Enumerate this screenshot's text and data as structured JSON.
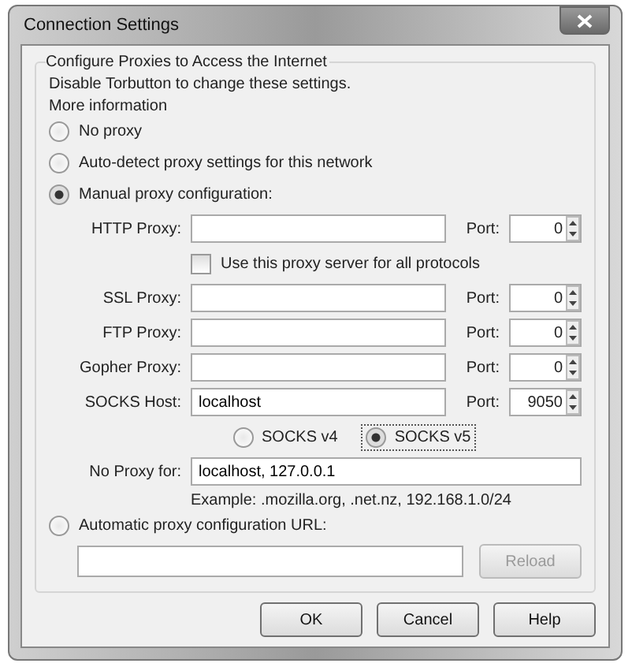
{
  "window": {
    "title": "Connection Settings"
  },
  "group": {
    "legend": "Configure Proxies to Access the Internet",
    "notes": [
      "Disable Torbutton to change these settings.",
      "More information"
    ]
  },
  "modes": [
    {
      "label": "No proxy",
      "selected": false
    },
    {
      "label": "Auto-detect proxy settings for this network",
      "selected": false
    },
    {
      "label": "Manual proxy configuration:",
      "selected": true
    }
  ],
  "proxies": [
    {
      "label": "HTTP Proxy:",
      "port_label": "Port:",
      "port": "0"
    },
    {
      "label": "SSL Proxy:",
      "port_label": "Port:",
      "port": "0"
    },
    {
      "label": "FTP Proxy:",
      "port_label": "Port:",
      "port": "0"
    },
    {
      "label": "Gopher Proxy:",
      "port_label": "Port:",
      "port": "0"
    },
    {
      "label": "SOCKS Host:",
      "value": "localhost",
      "port_label": "Port:",
      "port": "9050"
    }
  ],
  "share_all": {
    "label": "Use this proxy server for all protocols",
    "checked": false
  },
  "socks_versions": [
    {
      "label": "SOCKS v4",
      "selected": false
    },
    {
      "label": "SOCKS v5",
      "selected": true
    }
  ],
  "no_proxy": {
    "label": "No Proxy for:",
    "value": "localhost, 127.0.0.1",
    "example": "Example: .mozilla.org, .net.nz, 192.168.1.0/24"
  },
  "auto_url": {
    "label": "Automatic proxy configuration URL:",
    "selected": false,
    "reload": {
      "label": "Reload",
      "disabled": true
    }
  },
  "buttons": [
    {
      "label": "OK"
    },
    {
      "label": "Cancel"
    },
    {
      "label": "Help"
    }
  ]
}
